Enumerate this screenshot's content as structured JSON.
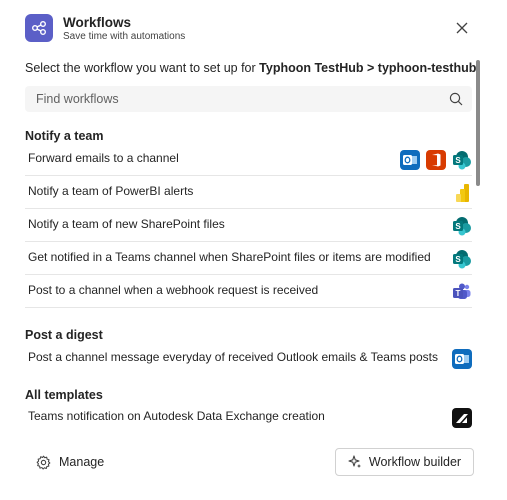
{
  "header": {
    "title": "Workflows",
    "subtitle": "Save time with automations",
    "app_icon": "workflows-icon",
    "close_icon": "close-icon"
  },
  "prompt": {
    "text": "Select the workflow you want to set up for ",
    "target": "Typhoon TestHub > typhoon-testhub."
  },
  "search": {
    "placeholder": "Find workflows",
    "value": "",
    "icon": "search-icon"
  },
  "sections": [
    {
      "title": "Notify a team",
      "items": [
        {
          "label": "Forward emails to a channel",
          "icons": [
            "outlook-icon",
            "office-icon",
            "sharepoint-icon"
          ]
        },
        {
          "label": "Notify a team of PowerBI alerts",
          "icons": [
            "powerbi-icon"
          ]
        },
        {
          "label": "Notify a team of new SharePoint files",
          "icons": [
            "sharepoint-icon"
          ]
        },
        {
          "label": "Get notified in a Teams channel when SharePoint files or items are modified",
          "icons": [
            "sharepoint-icon"
          ]
        },
        {
          "label": "Post to a channel when a webhook request is received",
          "icons": [
            "teams-icon"
          ]
        }
      ]
    },
    {
      "title": "Post a digest",
      "items": [
        {
          "label": "Post a channel message everyday of received Outlook emails & Teams posts",
          "icons": [
            "outlook-icon"
          ]
        }
      ]
    },
    {
      "title": "All templates",
      "items": [
        {
          "label": "Teams notification on Autodesk Data Exchange creation",
          "icons": [
            "autodesk-icon"
          ]
        }
      ]
    }
  ],
  "footer": {
    "manage_label": "Manage",
    "manage_icon": "gear-icon",
    "builder_label": "Workflow builder",
    "builder_icon": "sparkle-icon"
  },
  "colors": {
    "accent": "#5b5fc7",
    "outlook": "#0f6cbd",
    "office": "#d83b01",
    "sharepoint": "#038387",
    "powerbi": "#f2c811",
    "teams": "#5b5fc7",
    "autodesk": "#111111"
  }
}
